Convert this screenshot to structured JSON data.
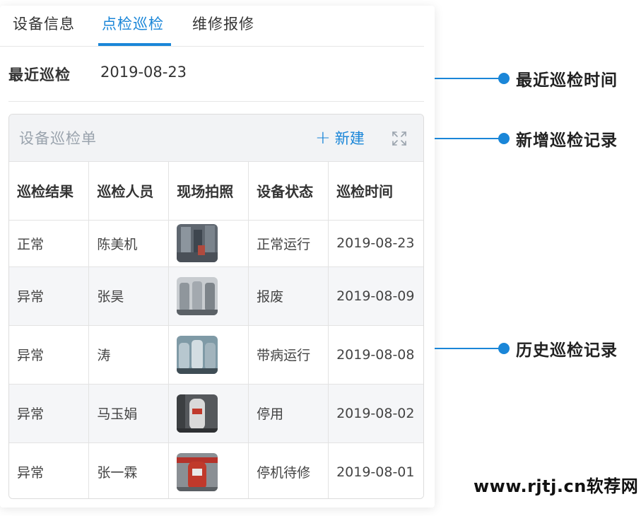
{
  "tabs": [
    {
      "label": "设备信息"
    },
    {
      "label": "点检巡检",
      "active": true
    },
    {
      "label": "维修报修"
    }
  ],
  "latest": {
    "label": "最近巡检",
    "value": "2019-08-23"
  },
  "card": {
    "title": "设备巡检单",
    "add_label": "新建",
    "add_icon": "plus-icon",
    "expand_icon": "expand-icon"
  },
  "table": {
    "headers": [
      "巡检结果",
      "巡检人员",
      "现场拍照",
      "设备状态",
      "巡检时间"
    ],
    "rows": [
      {
        "result": "正常",
        "person": "陈美机",
        "photo": "site-photo",
        "status": "正常运行",
        "time": "2019-08-23"
      },
      {
        "result": "异常",
        "person": "张昊",
        "photo": "site-photo",
        "status": "报废",
        "time": "2019-08-09"
      },
      {
        "result": "异常",
        "person": "涛",
        "photo": "site-photo",
        "status": "带病运行",
        "time": "2019-08-08"
      },
      {
        "result": "异常",
        "person": "马玉娟",
        "photo": "site-photo",
        "status": "停用",
        "time": "2019-08-02"
      },
      {
        "result": "异常",
        "person": "张一霖",
        "photo": "site-photo",
        "status": "停机待修",
        "time": "2019-08-01"
      }
    ]
  },
  "annotations": [
    {
      "text": "最近巡检时间"
    },
    {
      "text": "新增巡检记录"
    },
    {
      "text": "历史巡检记录"
    }
  ],
  "watermark": "www.rjtj.cn软荐网",
  "colors": {
    "accent": "#1a86d8",
    "stripe": "#f5f6f8",
    "card_head": "#f2f3f5"
  }
}
